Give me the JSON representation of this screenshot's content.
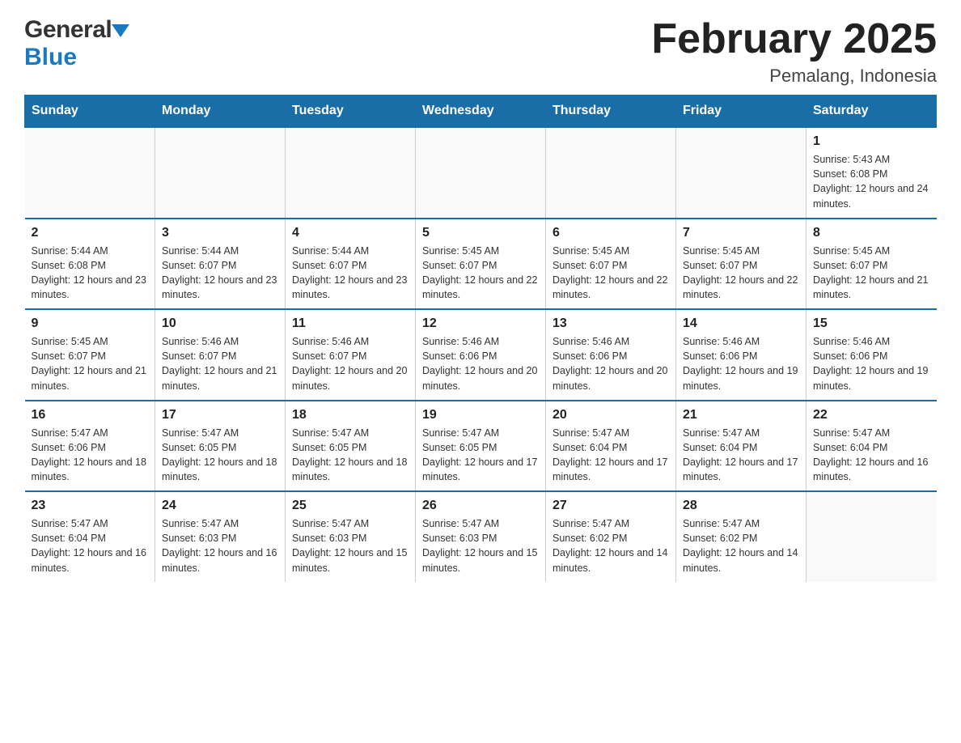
{
  "header": {
    "logo_general": "General",
    "logo_blue": "Blue",
    "month_title": "February 2025",
    "location": "Pemalang, Indonesia"
  },
  "days_of_week": [
    "Sunday",
    "Monday",
    "Tuesday",
    "Wednesday",
    "Thursday",
    "Friday",
    "Saturday"
  ],
  "weeks": [
    [
      {
        "day": "",
        "info": ""
      },
      {
        "day": "",
        "info": ""
      },
      {
        "day": "",
        "info": ""
      },
      {
        "day": "",
        "info": ""
      },
      {
        "day": "",
        "info": ""
      },
      {
        "day": "",
        "info": ""
      },
      {
        "day": "1",
        "info": "Sunrise: 5:43 AM\nSunset: 6:08 PM\nDaylight: 12 hours and 24 minutes."
      }
    ],
    [
      {
        "day": "2",
        "info": "Sunrise: 5:44 AM\nSunset: 6:08 PM\nDaylight: 12 hours and 23 minutes."
      },
      {
        "day": "3",
        "info": "Sunrise: 5:44 AM\nSunset: 6:07 PM\nDaylight: 12 hours and 23 minutes."
      },
      {
        "day": "4",
        "info": "Sunrise: 5:44 AM\nSunset: 6:07 PM\nDaylight: 12 hours and 23 minutes."
      },
      {
        "day": "5",
        "info": "Sunrise: 5:45 AM\nSunset: 6:07 PM\nDaylight: 12 hours and 22 minutes."
      },
      {
        "day": "6",
        "info": "Sunrise: 5:45 AM\nSunset: 6:07 PM\nDaylight: 12 hours and 22 minutes."
      },
      {
        "day": "7",
        "info": "Sunrise: 5:45 AM\nSunset: 6:07 PM\nDaylight: 12 hours and 22 minutes."
      },
      {
        "day": "8",
        "info": "Sunrise: 5:45 AM\nSunset: 6:07 PM\nDaylight: 12 hours and 21 minutes."
      }
    ],
    [
      {
        "day": "9",
        "info": "Sunrise: 5:45 AM\nSunset: 6:07 PM\nDaylight: 12 hours and 21 minutes."
      },
      {
        "day": "10",
        "info": "Sunrise: 5:46 AM\nSunset: 6:07 PM\nDaylight: 12 hours and 21 minutes."
      },
      {
        "day": "11",
        "info": "Sunrise: 5:46 AM\nSunset: 6:07 PM\nDaylight: 12 hours and 20 minutes."
      },
      {
        "day": "12",
        "info": "Sunrise: 5:46 AM\nSunset: 6:06 PM\nDaylight: 12 hours and 20 minutes."
      },
      {
        "day": "13",
        "info": "Sunrise: 5:46 AM\nSunset: 6:06 PM\nDaylight: 12 hours and 20 minutes."
      },
      {
        "day": "14",
        "info": "Sunrise: 5:46 AM\nSunset: 6:06 PM\nDaylight: 12 hours and 19 minutes."
      },
      {
        "day": "15",
        "info": "Sunrise: 5:46 AM\nSunset: 6:06 PM\nDaylight: 12 hours and 19 minutes."
      }
    ],
    [
      {
        "day": "16",
        "info": "Sunrise: 5:47 AM\nSunset: 6:06 PM\nDaylight: 12 hours and 18 minutes."
      },
      {
        "day": "17",
        "info": "Sunrise: 5:47 AM\nSunset: 6:05 PM\nDaylight: 12 hours and 18 minutes."
      },
      {
        "day": "18",
        "info": "Sunrise: 5:47 AM\nSunset: 6:05 PM\nDaylight: 12 hours and 18 minutes."
      },
      {
        "day": "19",
        "info": "Sunrise: 5:47 AM\nSunset: 6:05 PM\nDaylight: 12 hours and 17 minutes."
      },
      {
        "day": "20",
        "info": "Sunrise: 5:47 AM\nSunset: 6:04 PM\nDaylight: 12 hours and 17 minutes."
      },
      {
        "day": "21",
        "info": "Sunrise: 5:47 AM\nSunset: 6:04 PM\nDaylight: 12 hours and 17 minutes."
      },
      {
        "day": "22",
        "info": "Sunrise: 5:47 AM\nSunset: 6:04 PM\nDaylight: 12 hours and 16 minutes."
      }
    ],
    [
      {
        "day": "23",
        "info": "Sunrise: 5:47 AM\nSunset: 6:04 PM\nDaylight: 12 hours and 16 minutes."
      },
      {
        "day": "24",
        "info": "Sunrise: 5:47 AM\nSunset: 6:03 PM\nDaylight: 12 hours and 16 minutes."
      },
      {
        "day": "25",
        "info": "Sunrise: 5:47 AM\nSunset: 6:03 PM\nDaylight: 12 hours and 15 minutes."
      },
      {
        "day": "26",
        "info": "Sunrise: 5:47 AM\nSunset: 6:03 PM\nDaylight: 12 hours and 15 minutes."
      },
      {
        "day": "27",
        "info": "Sunrise: 5:47 AM\nSunset: 6:02 PM\nDaylight: 12 hours and 14 minutes."
      },
      {
        "day": "28",
        "info": "Sunrise: 5:47 AM\nSunset: 6:02 PM\nDaylight: 12 hours and 14 minutes."
      },
      {
        "day": "",
        "info": ""
      }
    ]
  ]
}
